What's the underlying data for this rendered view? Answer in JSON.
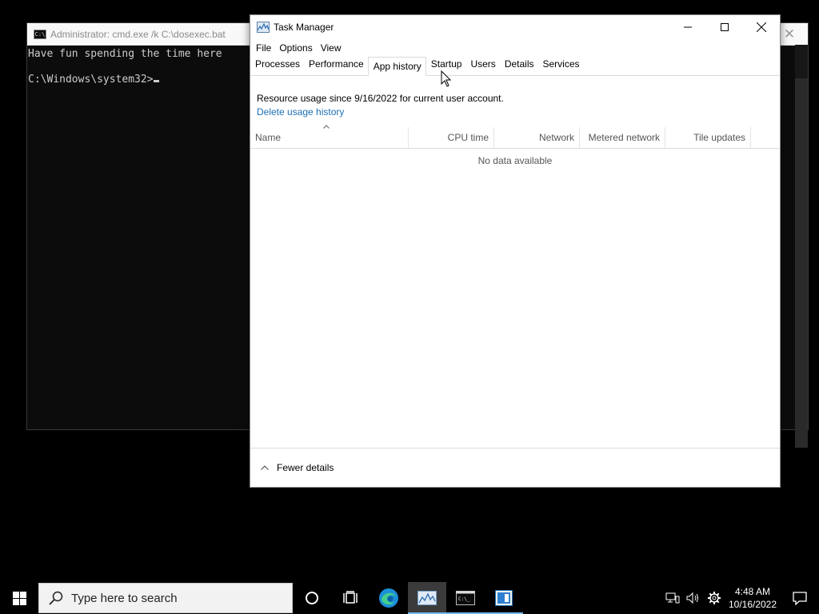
{
  "cmd": {
    "title": "Administrator: cmd.exe /k C:\\dosexec.bat",
    "line1": "Have fun spending the time here",
    "prompt": "C:\\Windows\\system32>",
    "close_label": "✕"
  },
  "task_manager": {
    "title": "Task Manager",
    "menu": [
      "File",
      "Options",
      "View"
    ],
    "tabs": [
      "Processes",
      "Performance",
      "App history",
      "Startup",
      "Users",
      "Details",
      "Services"
    ],
    "active_tab": "App history",
    "usage_text": "Resource usage since 9/16/2022 for current user account.",
    "delete_link": "Delete usage history",
    "columns": [
      "Name",
      "CPU time",
      "Network",
      "Metered network",
      "Tile updates"
    ],
    "empty_text": "No data available",
    "footer_label": "Fewer details"
  },
  "taskbar": {
    "search_placeholder": "Type here to search",
    "time": "4:48 AM",
    "date": "10/16/2022"
  },
  "colors": {
    "link": "#1e6fb5",
    "taskbar_running": "#76b9ed"
  }
}
